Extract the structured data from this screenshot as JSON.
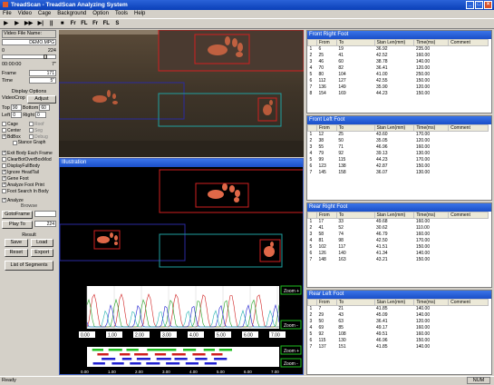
{
  "window": {
    "title": "TreadScan - TreadScan Analyzing System"
  },
  "menu": [
    "File",
    "Video",
    "Cage",
    "Background",
    "Option",
    "Tools",
    "Help"
  ],
  "toolbar": [
    "▶",
    "▶",
    "▶▶",
    "▶|",
    "||",
    "■",
    "Fr",
    "FL",
    "Fr",
    "FL",
    "S"
  ],
  "left": {
    "video_file_label": "Video File Name:",
    "video_file": "DEMO.MPG",
    "range_start": "0",
    "range_end": "224",
    "time_start": "00:00:00",
    "time_end": "7\"",
    "frame_label": "Frame",
    "frame_value": "171",
    "time_label": "Time",
    "time_value": "5\"",
    "display_options": "Display Options",
    "video_crop": "VideoCrop",
    "adjust": "Adjust",
    "top_label": "Top",
    "top_value": "90",
    "bottom_label": "Bottom",
    "bottom_value": "60",
    "left_label": "Left",
    "left_value": "0",
    "right_label": "Right",
    "right_value": "0",
    "checks_a": [
      [
        "Cage",
        "Roof"
      ],
      [
        "Center",
        "Seg"
      ],
      [
        "BdBox",
        "Debug"
      ]
    ],
    "stance_graph": "Stance Graph",
    "checks_b": [
      "Exit Body Each Frame",
      "ClearBotOverBoxMod",
      "DisplayFullBody",
      "Ignore HeadTail",
      "Gene Foot",
      "Analyze Foot Print",
      "Foot Search In Body",
      "Analyze"
    ],
    "browse": "Browse",
    "goto_frame": "GotoFrame",
    "play_to": "Play To",
    "play_to_value": "224",
    "result": "Result",
    "save": "Save",
    "load": "Load",
    "reset": "Reset",
    "export": "Export",
    "list_segments": "List of Segments"
  },
  "illustration": {
    "title": "Illustration",
    "zoom_plus": "Zoom +",
    "zoom_minus": "Zoom -",
    "ticks": [
      "0.00",
      "1.00",
      "2.00",
      "3.00",
      "4.00",
      "5.00",
      "6.00",
      "7.00"
    ]
  },
  "tables": [
    {
      "title": "Front Right Foot",
      "rows": [
        [
          "1",
          "6",
          "19",
          "36.92",
          "235.00"
        ],
        [
          "2",
          "25",
          "41",
          "42.52",
          "160.00"
        ],
        [
          "3",
          "46",
          "60",
          "38.78",
          "140.00"
        ],
        [
          "4",
          "70",
          "82",
          "36.41",
          "120.00"
        ],
        [
          "5",
          "80",
          "104",
          "41.00",
          "250.00"
        ],
        [
          "6",
          "112",
          "127",
          "42.55",
          "150.00"
        ],
        [
          "7",
          "136",
          "149",
          "35.90",
          "120.00"
        ],
        [
          "8",
          "154",
          "169",
          "44.23",
          "150.00"
        ]
      ]
    },
    {
      "title": "Front Left Foot",
      "rows": [
        [
          "1",
          "12",
          "25",
          "43.60",
          "170.00"
        ],
        [
          "2",
          "38",
          "50",
          "35.05",
          "120.00"
        ],
        [
          "3",
          "55",
          "71",
          "46.96",
          "160.00"
        ],
        [
          "4",
          "79",
          "92",
          "39.13",
          "130.00"
        ],
        [
          "5",
          "99",
          "115",
          "44.23",
          "170.00"
        ],
        [
          "6",
          "123",
          "138",
          "42.87",
          "150.00"
        ],
        [
          "7",
          "145",
          "158",
          "36.07",
          "130.00"
        ]
      ]
    },
    {
      "title": "Rear Right Foot",
      "rows": [
        [
          "1",
          "17",
          "33",
          "49.68",
          "160.00"
        ],
        [
          "2",
          "41",
          "52",
          "30.62",
          "110.00"
        ],
        [
          "3",
          "58",
          "74",
          "46.79",
          "160.00"
        ],
        [
          "4",
          "81",
          "98",
          "42.50",
          "170.00"
        ],
        [
          "5",
          "102",
          "117",
          "41.51",
          "150.00"
        ],
        [
          "6",
          "126",
          "140",
          "41.34",
          "140.00"
        ],
        [
          "7",
          "148",
          "163",
          "43.21",
          "150.00"
        ]
      ]
    },
    {
      "title": "Rear Left Foot",
      "rows": [
        [
          "1",
          "7",
          "21",
          "41.85",
          "140.00"
        ],
        [
          "2",
          "29",
          "43",
          "45.09",
          "140.00"
        ],
        [
          "3",
          "50",
          "63",
          "36.41",
          "120.00"
        ],
        [
          "4",
          "69",
          "85",
          "49.17",
          "160.00"
        ],
        [
          "5",
          "92",
          "108",
          "49.51",
          "160.00"
        ],
        [
          "6",
          "115",
          "130",
          "46.96",
          "150.00"
        ],
        [
          "7",
          "137",
          "151",
          "41.85",
          "140.00"
        ]
      ]
    }
  ],
  "table_headers": [
    "",
    "From",
    "To",
    "Stan Len(mm)",
    "Time(ms)",
    "Comment"
  ],
  "status": {
    "left": "Ready",
    "num": "NUM"
  }
}
